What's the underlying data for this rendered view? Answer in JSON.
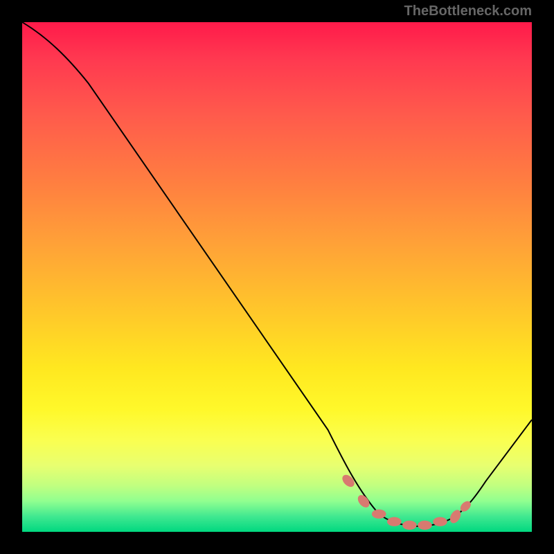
{
  "watermark": "TheBottleneck.com",
  "chart_data": {
    "type": "line",
    "title": "",
    "xlabel": "",
    "ylabel": "",
    "xlim": [
      0,
      100
    ],
    "ylim": [
      0,
      100
    ],
    "series": [
      {
        "name": "bottleneck-curve",
        "x": [
          0,
          7,
          15,
          25,
          60,
          66,
          70,
          75,
          80,
          85,
          88,
          100
        ],
        "y": [
          100,
          96,
          90,
          80,
          20,
          8,
          3,
          1,
          1,
          2,
          4,
          22
        ]
      }
    ],
    "markers": {
      "name": "optimum-zone",
      "color": "#d87a70",
      "points": [
        {
          "x": 64,
          "y": 10
        },
        {
          "x": 67,
          "y": 6
        },
        {
          "x": 70,
          "y": 3
        },
        {
          "x": 73,
          "y": 2
        },
        {
          "x": 76,
          "y": 1.5
        },
        {
          "x": 79,
          "y": 1.5
        },
        {
          "x": 82,
          "y": 2
        },
        {
          "x": 85,
          "y": 3
        },
        {
          "x": 87,
          "y": 5
        }
      ]
    },
    "background": "heat-gradient"
  }
}
